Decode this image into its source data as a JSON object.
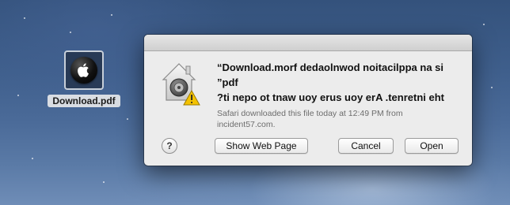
{
  "desktop": {
    "file_icon": {
      "name": "apple-logo-icon",
      "label": "Download.pdf"
    }
  },
  "dialog": {
    "icon": "security-house-lock-warning-icon",
    "message": "“Download.morf dedaolnwod noitacilppa na si ”pdf\n?ti nepo ot tnaw uoy erus uoy erA .tenretni eht",
    "info": "Safari downloaded this file today at 12:49 PM from incident57.com.",
    "help_label": "?",
    "buttons": {
      "show_web_page": "Show Web Page",
      "cancel": "Cancel",
      "open": "Open"
    }
  }
}
